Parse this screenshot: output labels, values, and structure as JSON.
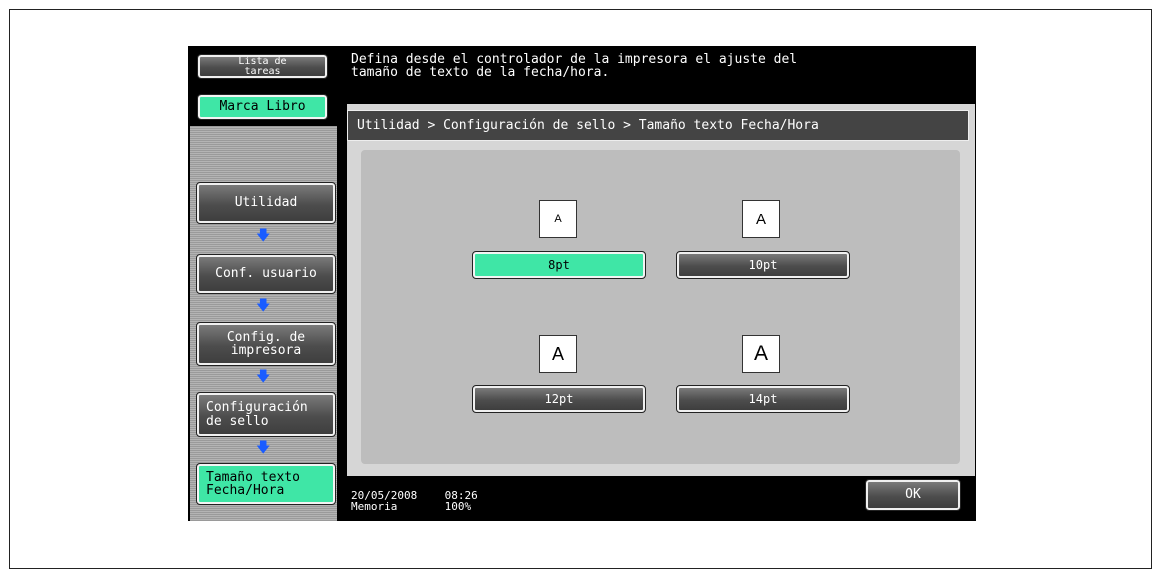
{
  "left": {
    "task_list_label": "Lista de tareas",
    "bookmark_label": "Marca Libro",
    "flow": [
      {
        "label": "Utilidad"
      },
      {
        "label": "Conf. usuario"
      },
      {
        "label": "Config. de impresora"
      },
      {
        "label": "Configuración de sello"
      },
      {
        "label": "Tamaño texto Fecha/Hora"
      }
    ]
  },
  "message": {
    "line1": "Defina desde el controlador de la impresora el ajuste del",
    "line2": "tamaño de texto de la fecha/hora."
  },
  "breadcrumb": "Utilidad > Configuración de sello > Tamaño texto Fecha/Hora",
  "sizes": [
    {
      "sample": "A",
      "label": "8pt",
      "selected": true
    },
    {
      "sample": "A",
      "label": "10pt",
      "selected": false
    },
    {
      "sample": "A",
      "label": "12pt",
      "selected": false
    },
    {
      "sample": "A",
      "label": "14pt",
      "selected": false
    }
  ],
  "status": {
    "date": "20/05/2008",
    "time": "08:26",
    "memory_label": "Memoria",
    "memory_value": "100%"
  },
  "ok_label": "OK",
  "colors": {
    "accent_green": "#3fe6a6",
    "flow_arrow": "#1a5cff"
  }
}
